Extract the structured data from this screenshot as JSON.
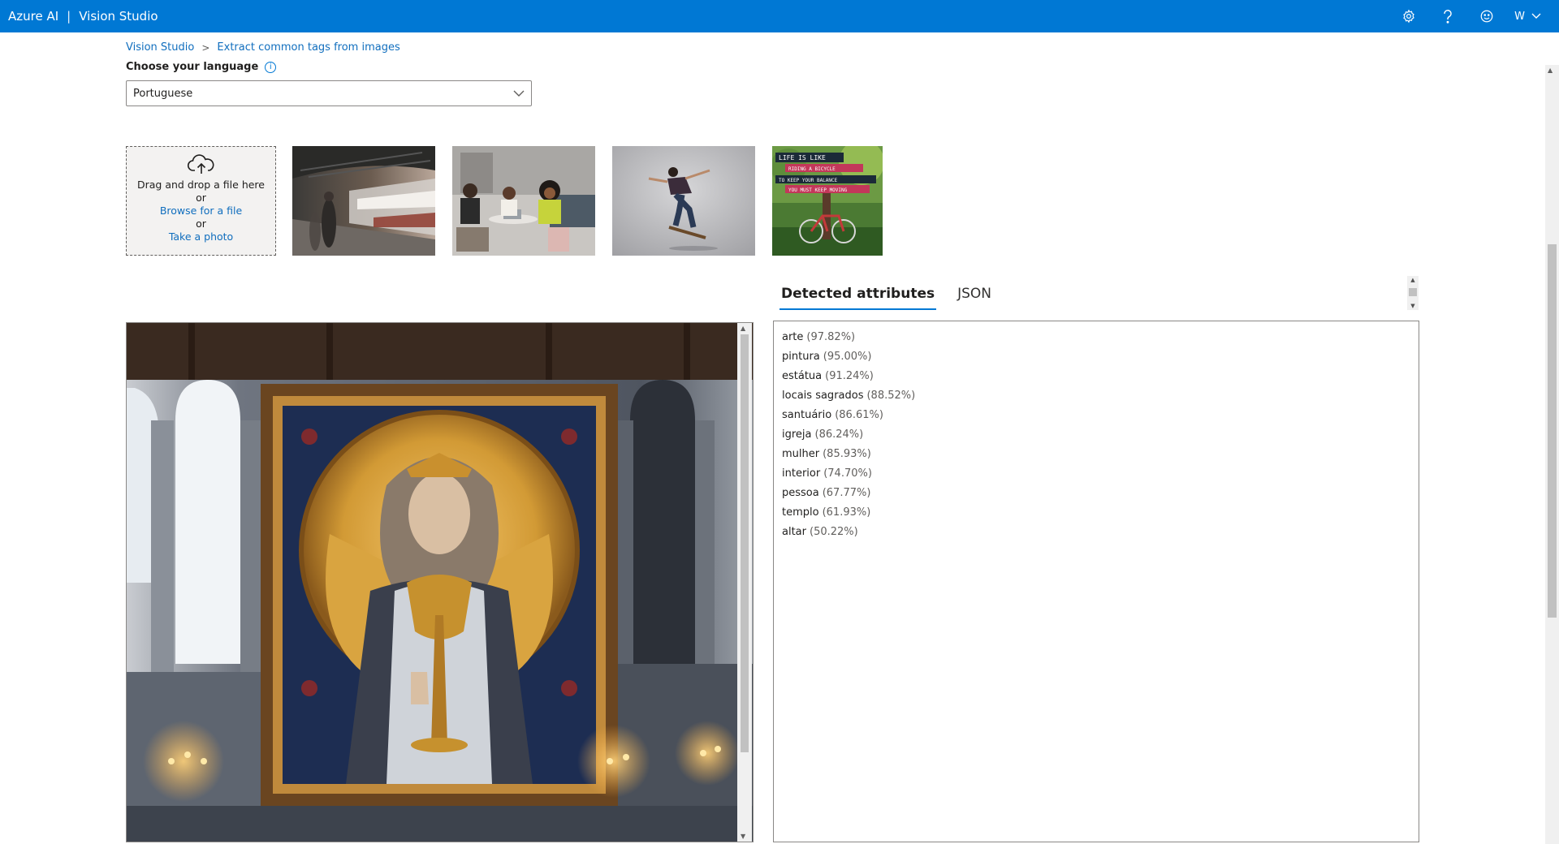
{
  "header": {
    "brand": "Azure AI",
    "separator": "|",
    "product": "Vision Studio",
    "user_initial": "W",
    "accent_color": "#0078d4",
    "icons": [
      "gear-icon",
      "help-icon",
      "smiley-icon",
      "chevron-down-icon"
    ]
  },
  "breadcrumb": {
    "home": "Vision Studio",
    "separator": ">",
    "current": "Extract common tags from images"
  },
  "language": {
    "label": "Choose your language",
    "info": "i",
    "selected": "Portuguese"
  },
  "upload": {
    "line1": "Drag and drop a file here",
    "or1": "or",
    "browse": "Browse for a file",
    "or2": "or",
    "take_photo": "Take a photo"
  },
  "thumbnail_text": {
    "line1": "LIFE IS LIKE",
    "line2": "RIDING A BICYCLE",
    "line3": "TO KEEP YOUR BALANCE",
    "line4": "YOU MUST KEEP MOVING"
  },
  "tabs": {
    "detected": "Detected attributes",
    "json": "JSON"
  },
  "tags": [
    {
      "name": "arte",
      "confidence": "(97.82%)"
    },
    {
      "name": "pintura",
      "confidence": "(95.00%)"
    },
    {
      "name": "estátua",
      "confidence": "(91.24%)"
    },
    {
      "name": "locais sagrados",
      "confidence": "(88.52%)"
    },
    {
      "name": "santuário",
      "confidence": "(86.61%)"
    },
    {
      "name": "igreja",
      "confidence": "(86.24%)"
    },
    {
      "name": "mulher",
      "confidence": "(85.93%)"
    },
    {
      "name": "interior",
      "confidence": "(74.70%)"
    },
    {
      "name": "pessoa",
      "confidence": "(67.77%)"
    },
    {
      "name": "templo",
      "confidence": "(61.93%)"
    },
    {
      "name": "altar",
      "confidence": "(50.22%)"
    }
  ]
}
